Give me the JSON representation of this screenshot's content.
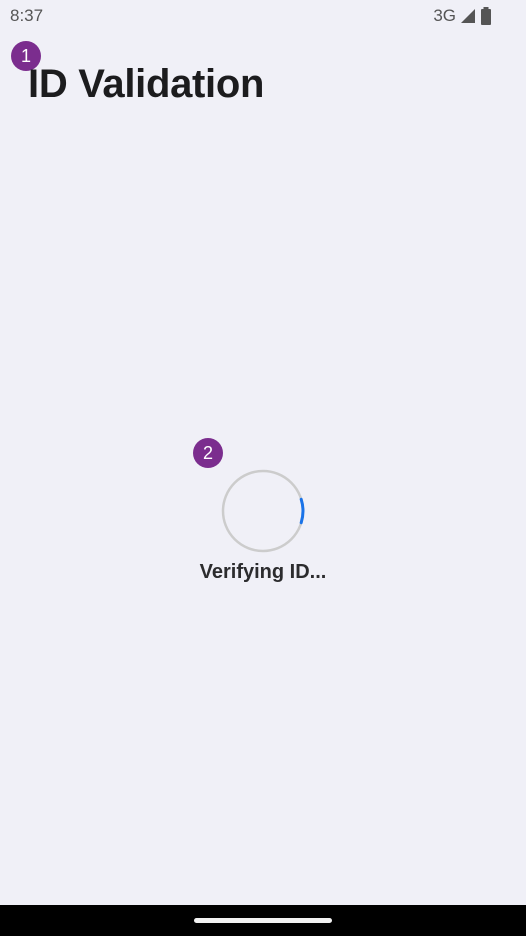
{
  "status_bar": {
    "time": "8:37",
    "network": "3G",
    "signal_icon": "cell-signal-icon",
    "battery_icon": "battery-icon"
  },
  "markers": {
    "first": "1",
    "second": "2"
  },
  "header": {
    "title": "ID Validation"
  },
  "loading": {
    "label": "Verifying ID...",
    "spinner_icon": "loading-spinner-icon",
    "accent_color": "#1a73e8",
    "track_color": "#cccccc"
  },
  "navigation": {
    "home_indicator": "home-indicator"
  }
}
